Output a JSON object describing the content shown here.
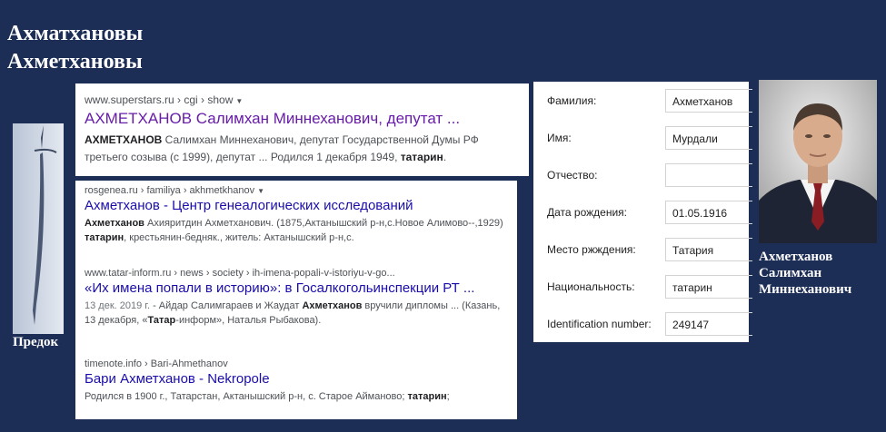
{
  "header": {
    "line1": "Ахматхановы",
    "line2": "Ахметхановы"
  },
  "ancestor_caption": "Предок",
  "card1": {
    "cite": "www.superstars.ru › cgi › show",
    "title": "АХМЕТХАНОВ Салимхан Миннеханович, депутат ...",
    "snippet_bold1": "АХМЕТХАНОВ",
    "snippet_text1": " Салимхан Миннеханович, депутат Государственной Думы РФ третьего созыва (с 1999), депутат ... Родился 1 декабря 1949, ",
    "snippet_bold2": "татарин",
    "snippet_text2": "."
  },
  "card2": {
    "r1": {
      "cite": "rosgenea.ru › familiya › akhmetkhanov",
      "title": "Ахметханов - Центр генеалогических исследований",
      "bold1": "Ахметханов",
      "text1": " Ахияритдин Ахметханович. (1875,Актанышский р-н,с.Новое Алимово--,1929) ",
      "bold2": "татарин",
      "text2": ", крестьянин-бедняк., житель: Актанышский р-н,с."
    },
    "r2": {
      "cite": "www.tatar-inform.ru › news › society › ih-imena-popali-v-istoriyu-v-go...",
      "title": "«Их имена попали в историю»: в Госалкогольинспекции РТ ...",
      "date": "13 дек. 2019 г.",
      "text1": " - Айдар Салимгараев и Жаудат ",
      "bold1": "Ахметханов",
      "text2": " вручили дипломы ... (Казань, 13 декабря, «",
      "bold2": "Татар",
      "text3": "-информ», Наталья Рыбакова)."
    },
    "r3": {
      "cite": "timenote.info › Bari-Ahmethanov",
      "title": "Бари Ахметханов - Nekropole",
      "text1": "Родился в 1900 г., Татарстан, Актанышский р-н, с. Старое Айманово; ",
      "bold1": "татарин",
      "text2": ";"
    }
  },
  "form": {
    "rows": [
      {
        "label": "Фамилия:",
        "value": "Ахметханов"
      },
      {
        "label": "Имя:",
        "value": "Мурдали"
      },
      {
        "label": "Отчество:",
        "value": ""
      },
      {
        "label": "Дата рождения:",
        "value": "01.05.1916"
      },
      {
        "label": "Место ржждения:",
        "value": "Татария"
      },
      {
        "label": "Национальность:",
        "value": "татарин"
      },
      {
        "label": "Identification number:",
        "value": "249147"
      }
    ]
  },
  "portrait_caption": {
    "line1": "Ахметханов",
    "line2": "Салимхан",
    "line3": "Миннеханович"
  }
}
